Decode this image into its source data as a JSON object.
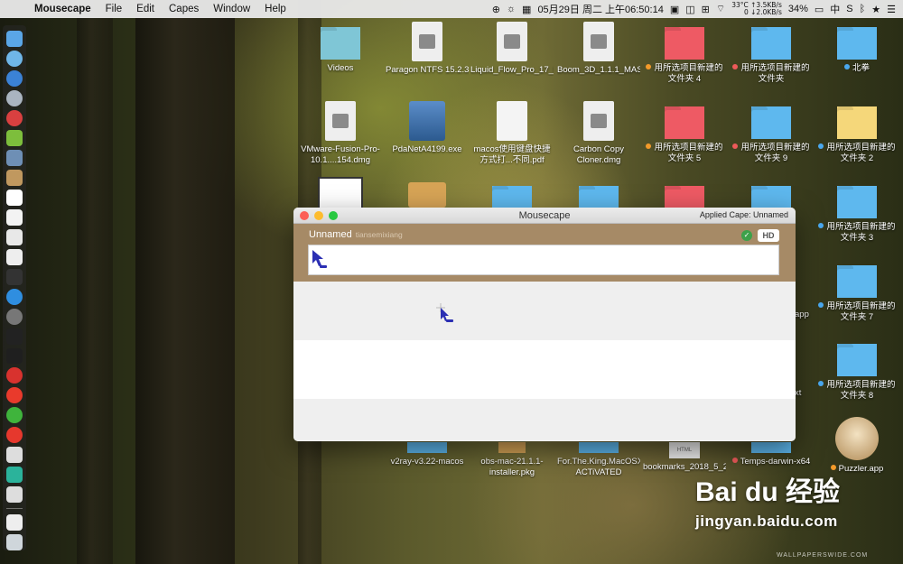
{
  "menubar": {
    "app_name": "Mousecape",
    "items": [
      "File",
      "Edit",
      "Capes",
      "Window",
      "Help"
    ],
    "datetime": "05月29日 周二 上午06:50:14",
    "temperature": "33°C",
    "net_up": "↑3.5KB/s",
    "net_down": "0 ↓2.0KB/s",
    "battery": "34%",
    "input_method": "中"
  },
  "desktop": {
    "icons": [
      {
        "label": "Videos",
        "kind": "folder-teal"
      },
      {
        "label": "Paragon NTFS 15.2.319...ark].dmg",
        "kind": "disk"
      },
      {
        "label": "Liquid_Flow_Pro_17_MAS_in...NT].dmg",
        "kind": "disk"
      },
      {
        "label": "Boom_3D_1.1.1_MAS_[TNT].dmg",
        "kind": "disk"
      },
      {
        "label": "用所选项目新建的文件夹 4",
        "kind": "folder-red",
        "dot": "orange"
      },
      {
        "label": "用所选项目新建的文件夹",
        "kind": "folder-blue",
        "dot": "red"
      },
      {
        "label": "北拳",
        "kind": "folder-blue",
        "dot": "blue"
      },
      {
        "label": "VMware-Fusion-Pro-10.1....154.dmg",
        "kind": "disk"
      },
      {
        "label": "PdaNetA4199.exe",
        "kind": "installer"
      },
      {
        "label": "macos使用键盘快捷方式打...不同.pdf",
        "kind": "doc"
      },
      {
        "label": "Carbon Copy Cloner.dmg",
        "kind": "disk"
      },
      {
        "label": "用所选项目新建的文件夹 5",
        "kind": "folder-red",
        "dot": "orange"
      },
      {
        "label": "用所选项目新建的文件夹 9",
        "kind": "folder-blue",
        "dot": "red"
      },
      {
        "label": "用所选项目新建的文件夹 2",
        "kind": "folder-yellow",
        "dot": "blue"
      },
      {
        "label": "用所选项目新建的文件夹 3",
        "kind": "folder-blue",
        "dot": "blue"
      },
      {
        "label": "用所选项目新建的文件夹 7",
        "kind": "folder-blue",
        "dot": "blue"
      },
      {
        "label": "用所选项目新建的文件夹 8",
        "kind": "folder-blue",
        "dot": "blue"
      },
      {
        "label": "v2ray-v3.22-macos",
        "kind": "folder-blue"
      },
      {
        "label": "obs-mac-21.1.1-installer.pkg",
        "kind": "package"
      },
      {
        "label": "For.The.King.MacOSX-ACTiVATED",
        "kind": "folder-blue"
      },
      {
        "label": "bookmarks_2018_5_21.html",
        "kind": "html"
      },
      {
        "label": "Temps-darwin-x64",
        "kind": "folder-blue",
        "dot": "red"
      },
      {
        "label": "Puzzler.app",
        "kind": "app",
        "dot": "orange"
      }
    ],
    "partial_labels": [
      "app",
      "xt"
    ]
  },
  "window": {
    "title": "Mousecape",
    "applied_cape": "Applied Cape: Unnamed",
    "cape": {
      "name": "Unnamed",
      "author": "tiansemixiang",
      "hd_label": "HD"
    }
  },
  "watermark": {
    "text": "Bai du 经验",
    "url": "jingyan.baidu.com",
    "credit": "WALLPAPERSWIDE.COM"
  },
  "colors": {
    "cape_row": "#a68a66",
    "menubar": "#e8e8e8",
    "folder_blue": "#5eb8ee",
    "folder_red": "#ee5a64"
  }
}
